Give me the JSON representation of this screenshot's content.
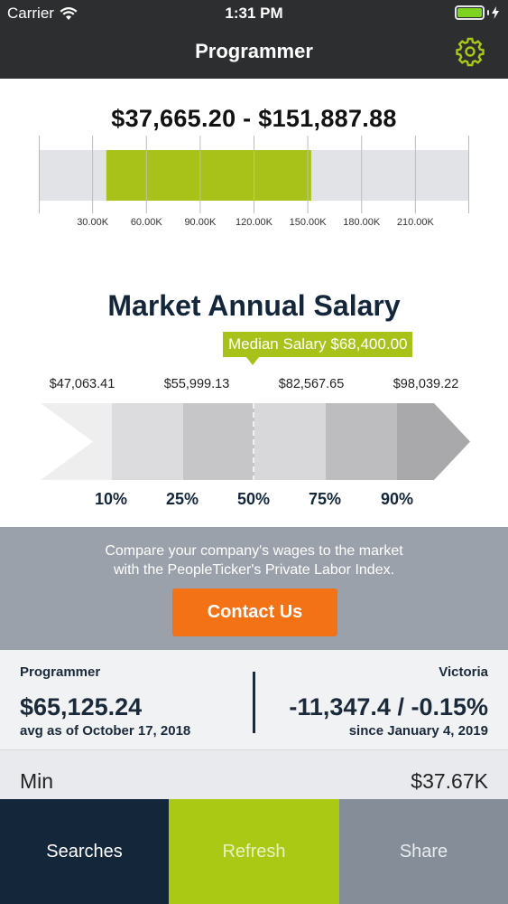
{
  "status_bar": {
    "carrier": "Carrier",
    "time": "1:31 PM",
    "battery_level": 1.0
  },
  "nav": {
    "title": "Programmer",
    "settings_icon": "gear-icon"
  },
  "range": {
    "title": "$37,665.20 - $151,887.88",
    "low": 37665.2,
    "high": 151887.88,
    "axis_min": 0,
    "axis_max": 240000,
    "ticks": [
      {
        "value": 30000,
        "label": "30.00K"
      },
      {
        "value": 60000,
        "label": "60.00K"
      },
      {
        "value": 90000,
        "label": "90.00K"
      },
      {
        "value": 120000,
        "label": "120.00K"
      },
      {
        "value": 150000,
        "label": "150.00K"
      },
      {
        "value": 180000,
        "label": "180.00K"
      },
      {
        "value": 210000,
        "label": "210.00K"
      }
    ],
    "bar_color": "#a8c21a",
    "track_color": "#e2e3e6"
  },
  "market": {
    "title": "Market Annual Salary",
    "median_label": "Median Salary $68,400.00",
    "values": [
      "$47,063.41",
      "$55,999.13",
      "$82,567.65",
      "$98,039.22"
    ],
    "percentiles": [
      "10%",
      "25%",
      "50%",
      "75%",
      "90%"
    ]
  },
  "contact": {
    "line1": "Compare your company's wages to the market",
    "line2": "with the PeopleTicker's Private Labor Index.",
    "button_label": "Contact Us",
    "button_color": "#f47216"
  },
  "stats": {
    "job": "Programmer",
    "avg_value": "$65,125.24",
    "avg_date": "avg as of October 17, 2018",
    "location": "Victoria",
    "change": "-11,347.4 / -0.15%",
    "since": "since January 4, 2019"
  },
  "min_row": {
    "label": "Min",
    "value": "$37.67K"
  },
  "tabs": {
    "searches": "Searches",
    "refresh": "Refresh",
    "share": "Share"
  }
}
